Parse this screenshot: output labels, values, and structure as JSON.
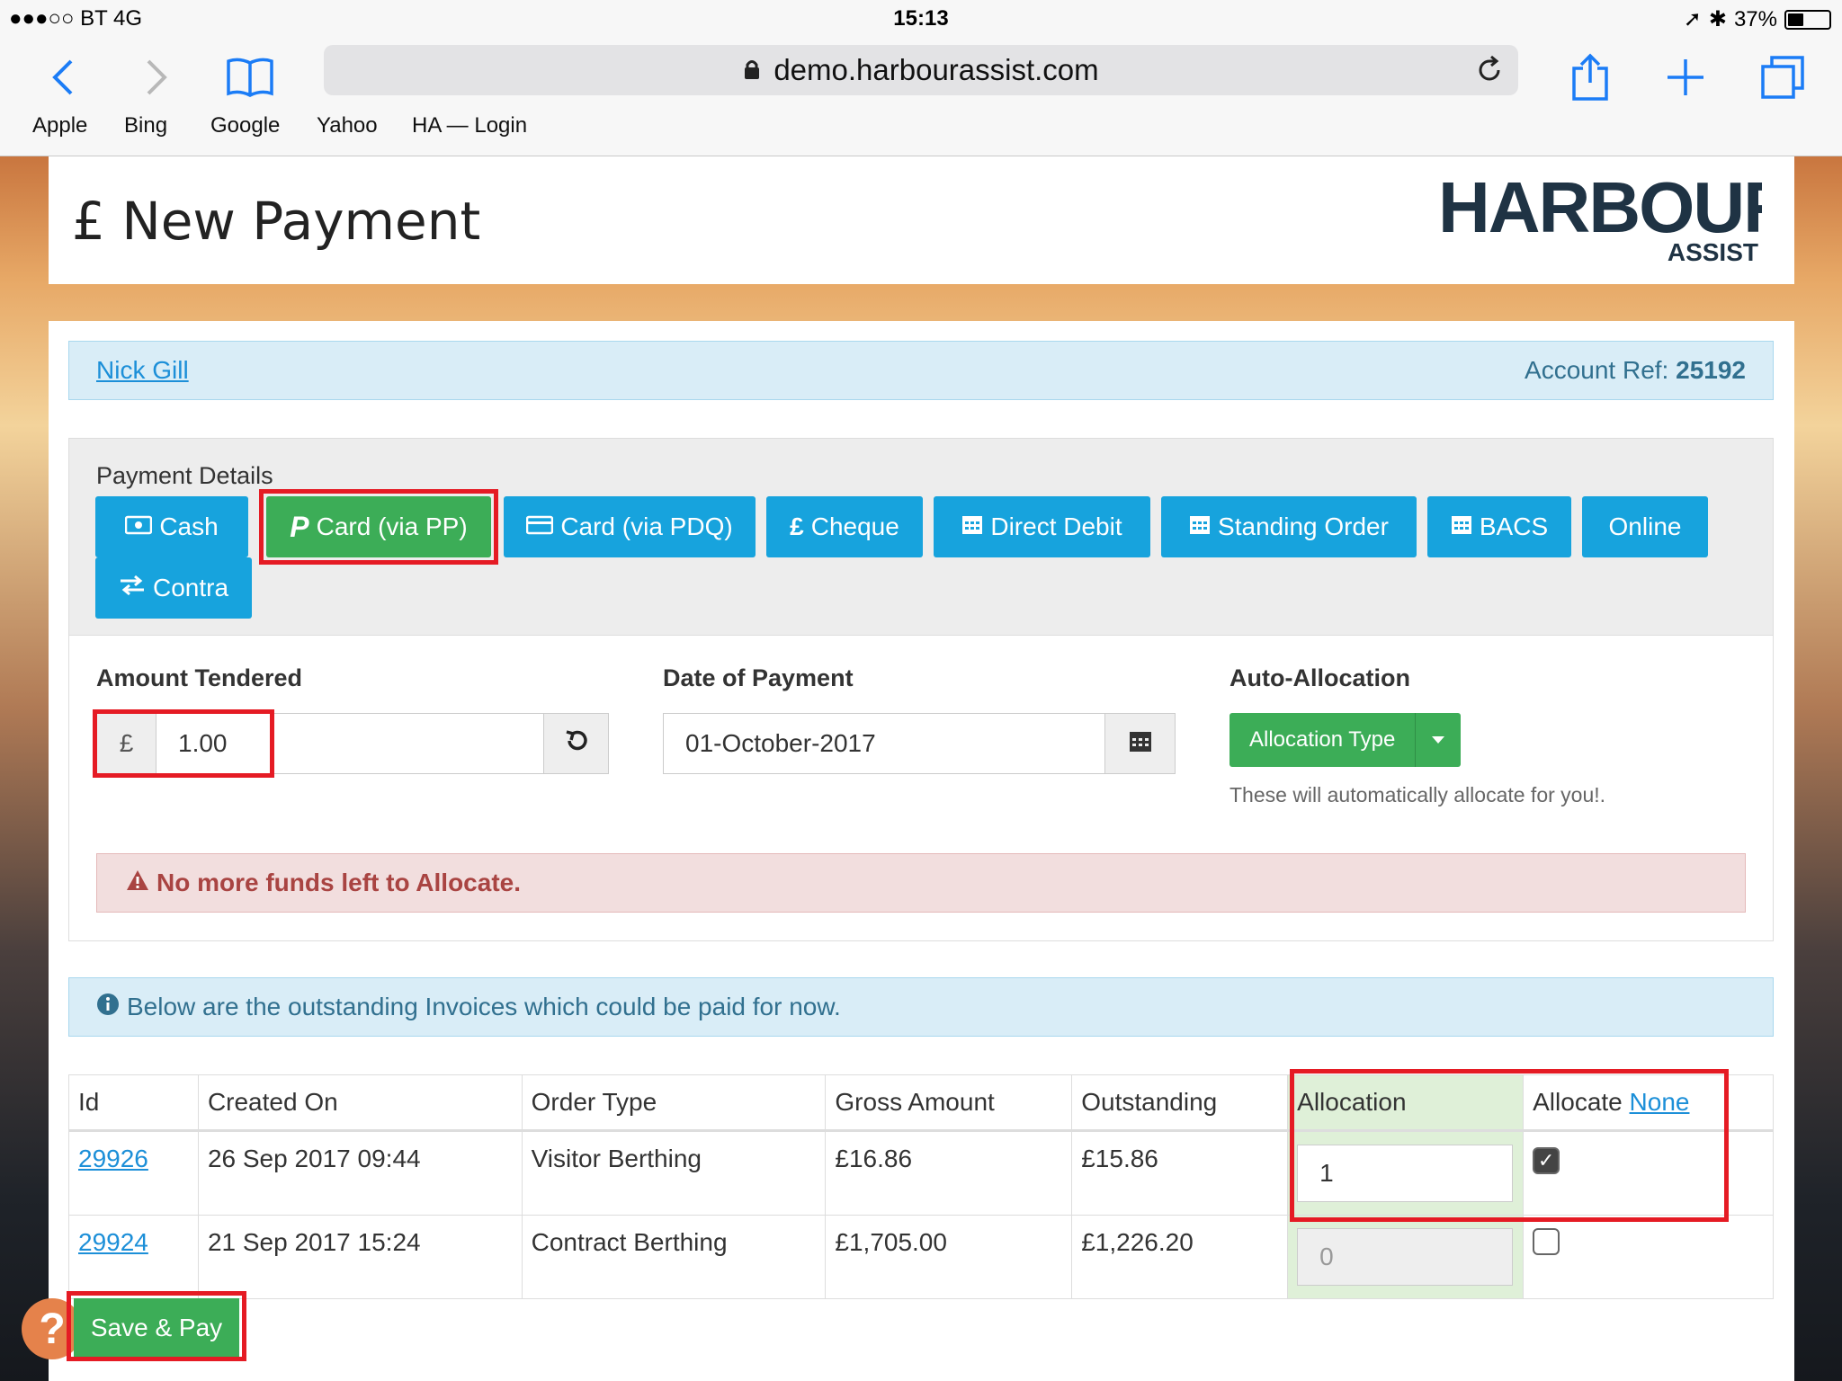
{
  "status": {
    "carrier": "●●●○○ BT  4G",
    "time": "15:13",
    "battery": "37%"
  },
  "browser": {
    "url": "demo.harbourassist.com",
    "bookmarks": [
      "Apple",
      "Bing",
      "Google",
      "Yahoo",
      "HA — Login"
    ]
  },
  "header": {
    "title": "£ New Payment",
    "logo_main": "HARBOUR",
    "logo_sub": "ASSIST"
  },
  "account": {
    "name": "Nick Gill",
    "ref_label": "Account Ref:",
    "ref_value": "25192"
  },
  "payment": {
    "label": "Payment Details",
    "methods": [
      "Cash",
      "Card (via PP)",
      "Card (via PDQ)",
      "Cheque",
      "Direct Debit",
      "Standing Order",
      "BACS",
      "Online",
      "Contra"
    ],
    "active_method": "Card (via PP)"
  },
  "form": {
    "amount_label": "Amount Tendered",
    "currency_symbol": "£",
    "amount_value": "1.00",
    "date_label": "Date of Payment",
    "date_value": "01-October-2017",
    "auto_label": "Auto-Allocation",
    "allocation_button": "Allocation Type",
    "auto_help": "These will automatically allocate for you!."
  },
  "alert": {
    "text": "No more funds left to Allocate."
  },
  "info": {
    "text": "Below are the outstanding Invoices which could be paid for now."
  },
  "table": {
    "headers": [
      "Id",
      "Created On",
      "Order Type",
      "Gross Amount",
      "Outstanding",
      "Allocation",
      "Allocate"
    ],
    "allocate_link": "None",
    "rows": [
      {
        "id": "29926",
        "created": "26 Sep 2017 09:44",
        "type": "Visitor Berthing",
        "gross": "£16.86",
        "outstanding": "£15.86",
        "allocation": "1",
        "checked": true
      },
      {
        "id": "29924",
        "created": "21 Sep 2017 15:24",
        "type": "Contract Berthing",
        "gross": "£1,705.00",
        "outstanding": "£1,226.20",
        "allocation": "0",
        "checked": false
      }
    ]
  },
  "actions": {
    "save": "Save & Pay",
    "help": "?"
  }
}
